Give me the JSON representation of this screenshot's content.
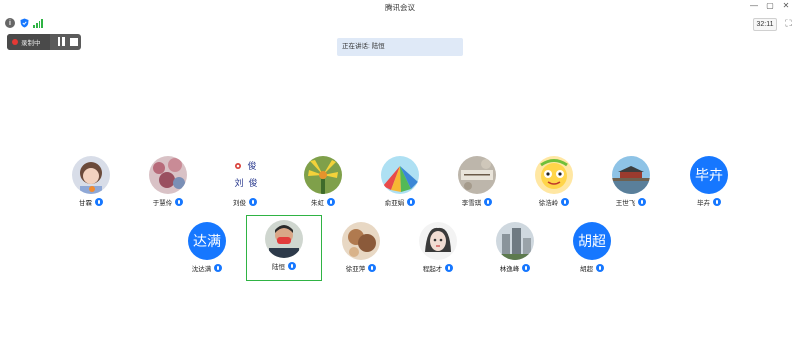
{
  "window": {
    "title": "腾讯会议",
    "minimize_icon": "minimize-icon",
    "maximize_icon": "maximize-icon",
    "close_icon": "close-icon"
  },
  "toolbar": {
    "timer": "32:11",
    "icons": [
      "info-icon",
      "shield-icon",
      "signal-icon",
      "fullscreen-icon"
    ]
  },
  "recording": {
    "label": "录制中",
    "status_color": "#e53935"
  },
  "speaking": {
    "text": "正在讲话: 陆恒"
  },
  "colors": {
    "accent": "#1677ff",
    "active_border": "#2fb344"
  },
  "participants": [
    {
      "name": "甘霖"
    },
    {
      "name": "于慧伶"
    },
    {
      "name": "刘俊",
      "avatar_text": [
        "刘",
        "俊"
      ]
    },
    {
      "name": "朱虹"
    },
    {
      "name": "俞亚娟"
    },
    {
      "name": "李雪琪"
    },
    {
      "name": "徐浩岭"
    },
    {
      "name": "王世飞"
    },
    {
      "name": "毕卉",
      "avatar_text": "毕卉"
    },
    {
      "name": "沈达满",
      "avatar_text": "达满"
    },
    {
      "name": "陆恒",
      "active": true
    },
    {
      "name": "徐亚萍"
    },
    {
      "name": "程起才"
    },
    {
      "name": "林逸峰"
    },
    {
      "name": "胡超",
      "avatar_text": "胡超"
    }
  ]
}
